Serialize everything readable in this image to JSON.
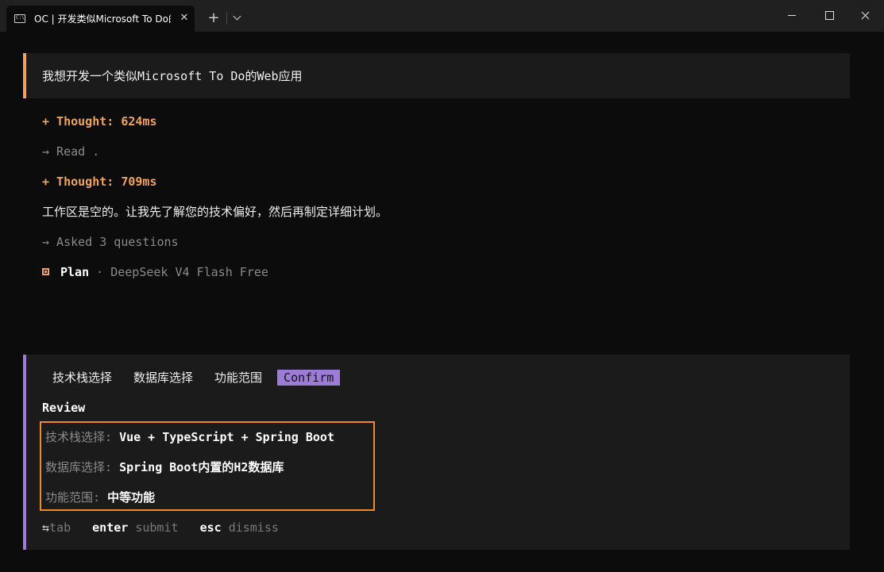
{
  "window": {
    "tab_title": "OC | 开发类似Microsoft To Do的",
    "tab_icon_text": "C:\\",
    "close_tab_glyph": "✕",
    "new_tab_glyph": "+"
  },
  "conversation": {
    "user_prompt": "我想开发一个类似Microsoft To Do的Web应用",
    "thought_1": "+ Thought: 624ms",
    "read_line": "→ Read .",
    "thought_2": "+ Thought: 709ms",
    "assistant_text": "工作区是空的。让我先了解您的技术偏好，然后再制定详细计划。",
    "asked_line": "→ Asked 3 questions",
    "plan_label": "Plan",
    "plan_model": " · DeepSeek V4 Flash Free"
  },
  "question_panel": {
    "tabs": [
      {
        "label": "技术栈选择",
        "active": false
      },
      {
        "label": "数据库选择",
        "active": false
      },
      {
        "label": "功能范围",
        "active": false
      },
      {
        "label": "Confirm",
        "active": true
      }
    ],
    "review_heading": "Review",
    "answers": [
      {
        "key": "技术栈选择: ",
        "value": "Vue + TypeScript + Spring Boot"
      },
      {
        "key": "数据库选择: ",
        "value": "Spring Boot内置的H2数据库"
      },
      {
        "key": "功能范围: ",
        "value": "中等功能"
      }
    ],
    "hints": {
      "tab_key": "⇆",
      "tab_desc": "tab",
      "enter_key": "enter",
      "enter_desc": "submit",
      "esc_key": "esc",
      "esc_desc": "dismiss"
    }
  },
  "colors": {
    "accent_orange": "#f0a35a",
    "accent_purple": "#9d7cd8",
    "highlight_box": "#f08a24"
  }
}
